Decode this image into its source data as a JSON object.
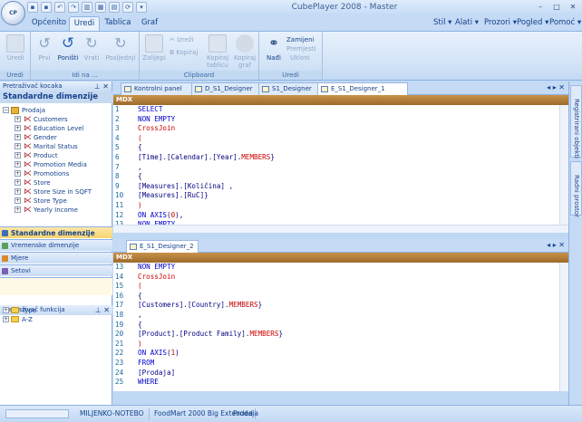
{
  "window": {
    "title": "CubePlayer 2008 - Master",
    "app_badge": "CP"
  },
  "qat_icons": [
    "save-icon",
    "save-all-icon",
    "undo-icon",
    "redo-icon",
    "chart-icon",
    "grid-icon",
    "export-icon",
    "refresh-icon",
    "customize-icon"
  ],
  "ribbon_tabs": [
    {
      "label": "Općenito"
    },
    {
      "label": "Uredi"
    },
    {
      "label": "Tablica"
    },
    {
      "label": "Graf"
    }
  ],
  "menu_right": [
    {
      "label": "Stil ▾"
    },
    {
      "label": "Alati ▾"
    },
    {
      "label": "Prozori ▾"
    },
    {
      "label": "Pogled ▾"
    },
    {
      "label": "Pomoć ▾"
    }
  ],
  "ribbon": {
    "groups": {
      "uredi1": "Uredi",
      "idinaa": "Idi na ...",
      "clipboard": "Clipboard",
      "uredi2": "Uredi"
    },
    "buttons": {
      "uredi": "Uredi",
      "prvi": "Prvi",
      "ponisti": "Poništi",
      "vrati": "Vrati",
      "posljednji": "Posljednji",
      "zalijepi": "Zalijepi",
      "izrezi": "Izreži",
      "kopiraj": "Kopiraj",
      "kopiraj_tablicu": "Kopiraj tablicu",
      "kopiraj_graf": "Kopiraj graf",
      "nadi": "Nađi",
      "zamijeni": "Zamijeni",
      "premjesti": "Premjesti",
      "ukloni": "Ukloni"
    }
  },
  "left": {
    "cube_browser_title": "Pretraživač kocaka",
    "dim_header": "Standardne dimenzije",
    "cube": "Prodaja",
    "dimensions": [
      "Customers",
      "Education Level",
      "Gender",
      "Marital Status",
      "Product",
      "Promotion Media",
      "Promotions",
      "Store",
      "Store Size in SQFT",
      "Store Type",
      "Yearly Income"
    ],
    "nav": [
      "Standardne dimenzije",
      "Vremenske dimenzije",
      "Mjere",
      "Setovi"
    ],
    "func_browser_title": "Pretraživač funkcija",
    "func_items": [
      "Type",
      "A-Z"
    ]
  },
  "doc_tabs": [
    {
      "label": "Kontrolni panel"
    },
    {
      "label": "D_S1_Designer"
    },
    {
      "label": "S1_Designer"
    },
    {
      "label": "E_S1_Designer_1"
    }
  ],
  "doc2_tab": "E_S1_Designer_2",
  "mdx_label": "MDX",
  "editor1": [
    {
      "n": "1",
      "t": "SELECT"
    },
    {
      "n": "2",
      "t": "NON EMPTY"
    },
    {
      "n": "3",
      "t": "CrossJoin"
    },
    {
      "n": "4",
      "t": "("
    },
    {
      "n": "5",
      "t": "{"
    },
    {
      "n": "6",
      "t": "[Time].[Calendar].[Year].MEMBERS}"
    },
    {
      "n": "7",
      "t": ","
    },
    {
      "n": "8",
      "t": "{"
    },
    {
      "n": "9",
      "t": "[Measures].[Količina] ,"
    },
    {
      "n": "10",
      "t": "[Measures].[RuC]}"
    },
    {
      "n": "11",
      "t": ")"
    },
    {
      "n": "12",
      "t": "ON AXIS(0),"
    },
    {
      "n": "13",
      "t": "NON EMPTY"
    }
  ],
  "editor2": [
    {
      "n": "13",
      "t": "NON EMPTY"
    },
    {
      "n": "14",
      "t": "CrossJoin"
    },
    {
      "n": "15",
      "t": "("
    },
    {
      "n": "16",
      "t": "{"
    },
    {
      "n": "17",
      "t": "[Customers].[Country].MEMBERS}"
    },
    {
      "n": "18",
      "t": ","
    },
    {
      "n": "19",
      "t": "{"
    },
    {
      "n": "20",
      "t": "[Product].[Product Family].MEMBERS}"
    },
    {
      "n": "21",
      "t": ")"
    },
    {
      "n": "22",
      "t": "ON AXIS(1)"
    },
    {
      "n": "23",
      "t": "FROM"
    },
    {
      "n": "24",
      "t": "[Prodaja]"
    },
    {
      "n": "25",
      "t": "WHERE"
    }
  ],
  "right_tabs": [
    "Registrirani objekti",
    "Radni prostor"
  ],
  "status": {
    "machine": "MILJENKO-NOTEBO",
    "db": "FoodMart 2000 Big Extended",
    "cube": "Prodaja"
  }
}
